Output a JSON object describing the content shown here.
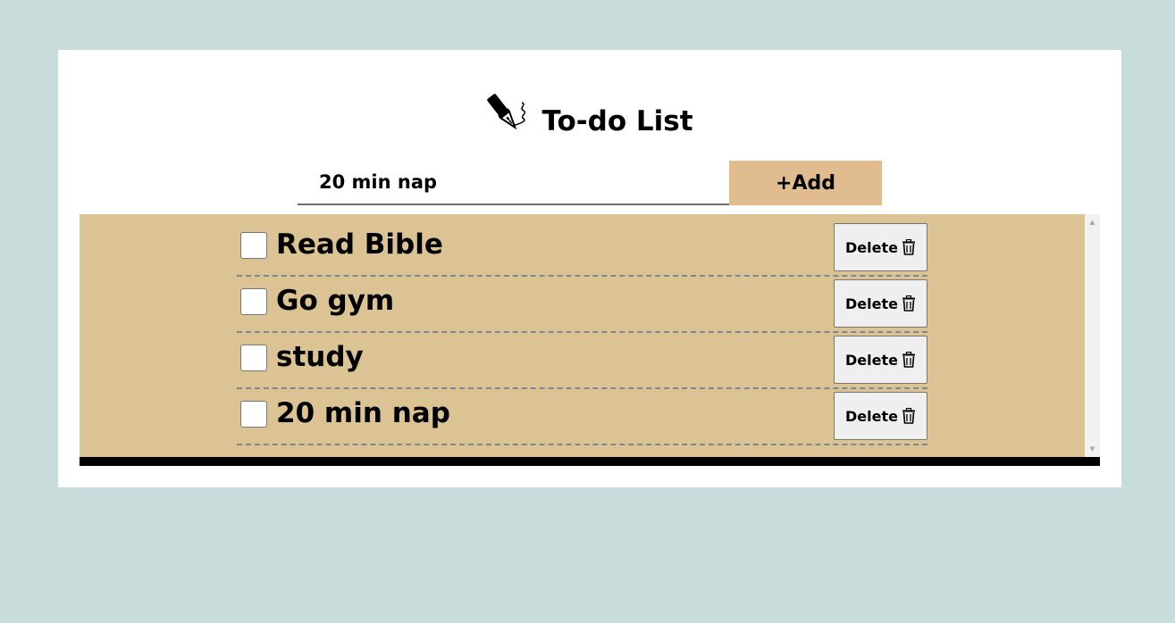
{
  "header": {
    "title": "To-do List",
    "icon": "fountain-pen-icon"
  },
  "input": {
    "value": "20 min nap",
    "placeholder": ""
  },
  "add_button": {
    "label": "+Add"
  },
  "items": [
    {
      "label": "Read Bible",
      "checked": false,
      "delete_label": "Delete"
    },
    {
      "label": "Go gym",
      "checked": false,
      "delete_label": "Delete"
    },
    {
      "label": "study",
      "checked": false,
      "delete_label": "Delete"
    },
    {
      "label": "20 min nap",
      "checked": false,
      "delete_label": "Delete"
    }
  ],
  "colors": {
    "page_background": "#c7dcdb",
    "card_background": "#ffffff",
    "add_button": "#e0bc8f",
    "list_background": "#dcc393"
  },
  "icons": {
    "delete": "trash-icon",
    "scroll_up": "scroll-up-arrow-icon",
    "scroll_down": "scroll-down-arrow-icon"
  }
}
